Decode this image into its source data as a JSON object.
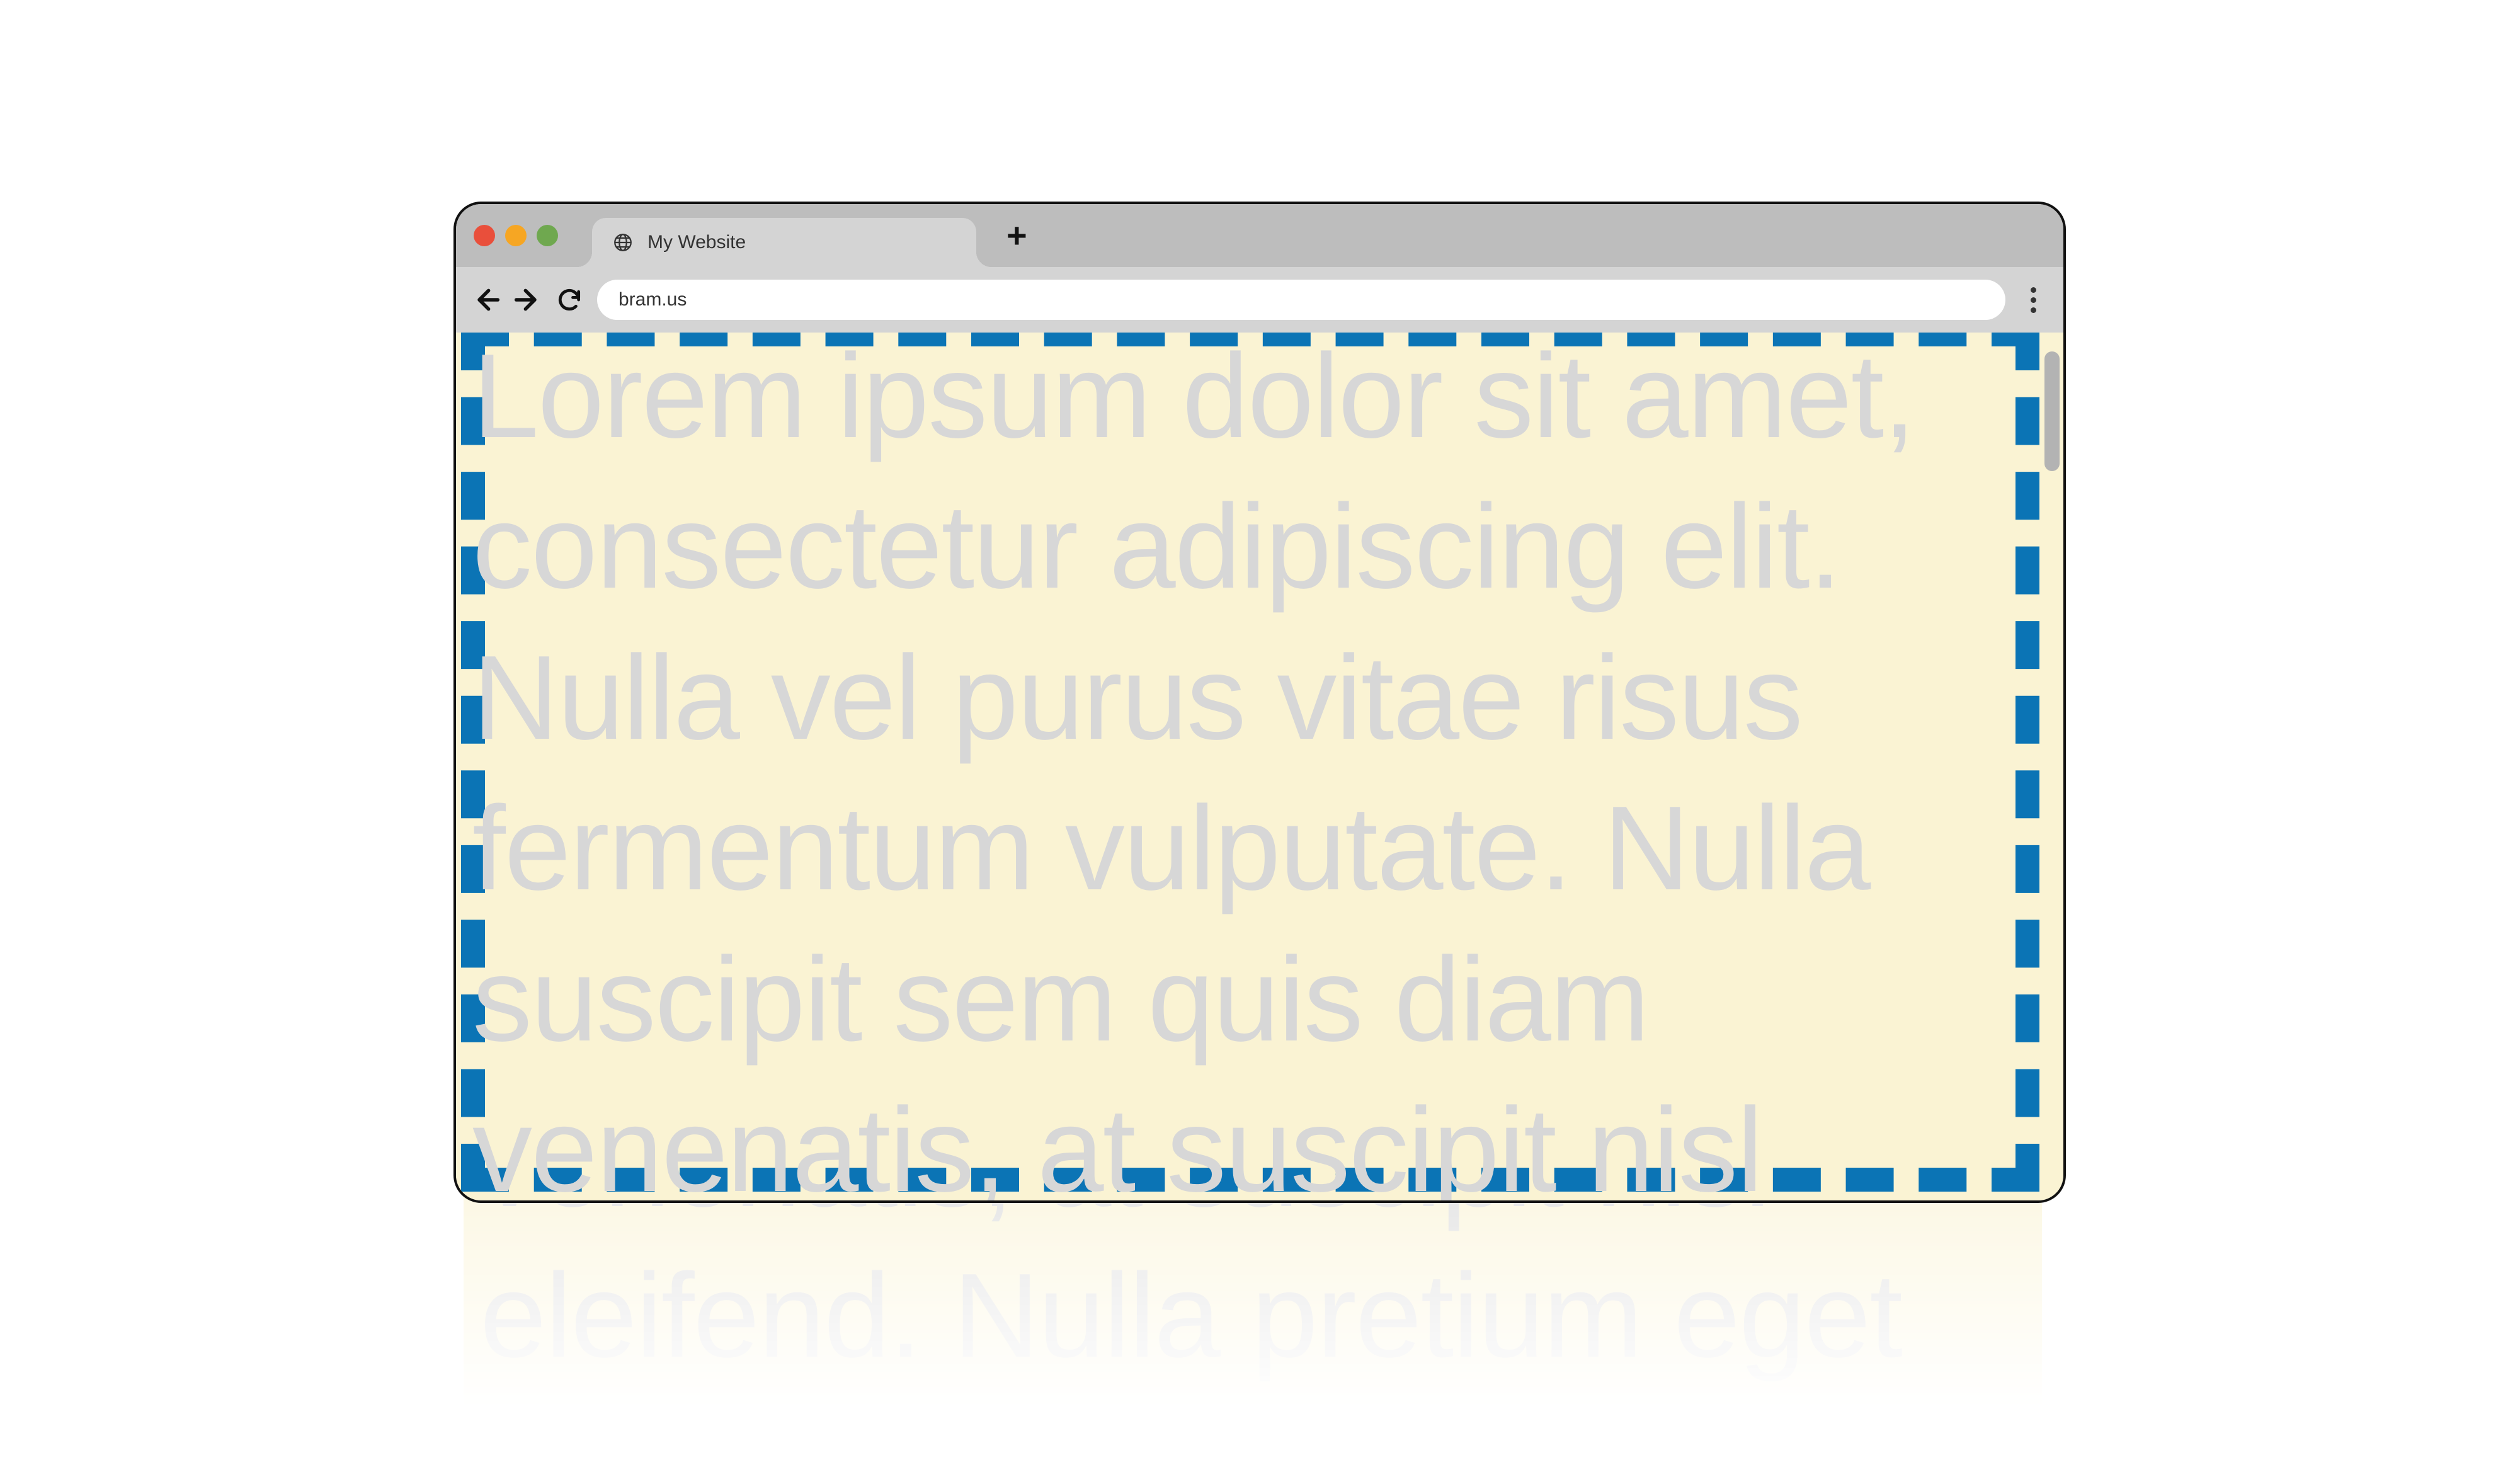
{
  "browser": {
    "tab_title": "My Website",
    "url": "bram.us"
  },
  "page": {
    "body_text": "Lorem ipsum dolor sit amet, consectetur adipiscing elit. Nulla vel purus vitae risus fermentum vulputate. Nulla suscipit sem quis diam venenatis, at suscipit nisl eleifend. Nulla pretium eget",
    "viewport_border_color": "#0b74b5",
    "background_color": "#faf3d3",
    "text_color": "#d7d7d7"
  }
}
